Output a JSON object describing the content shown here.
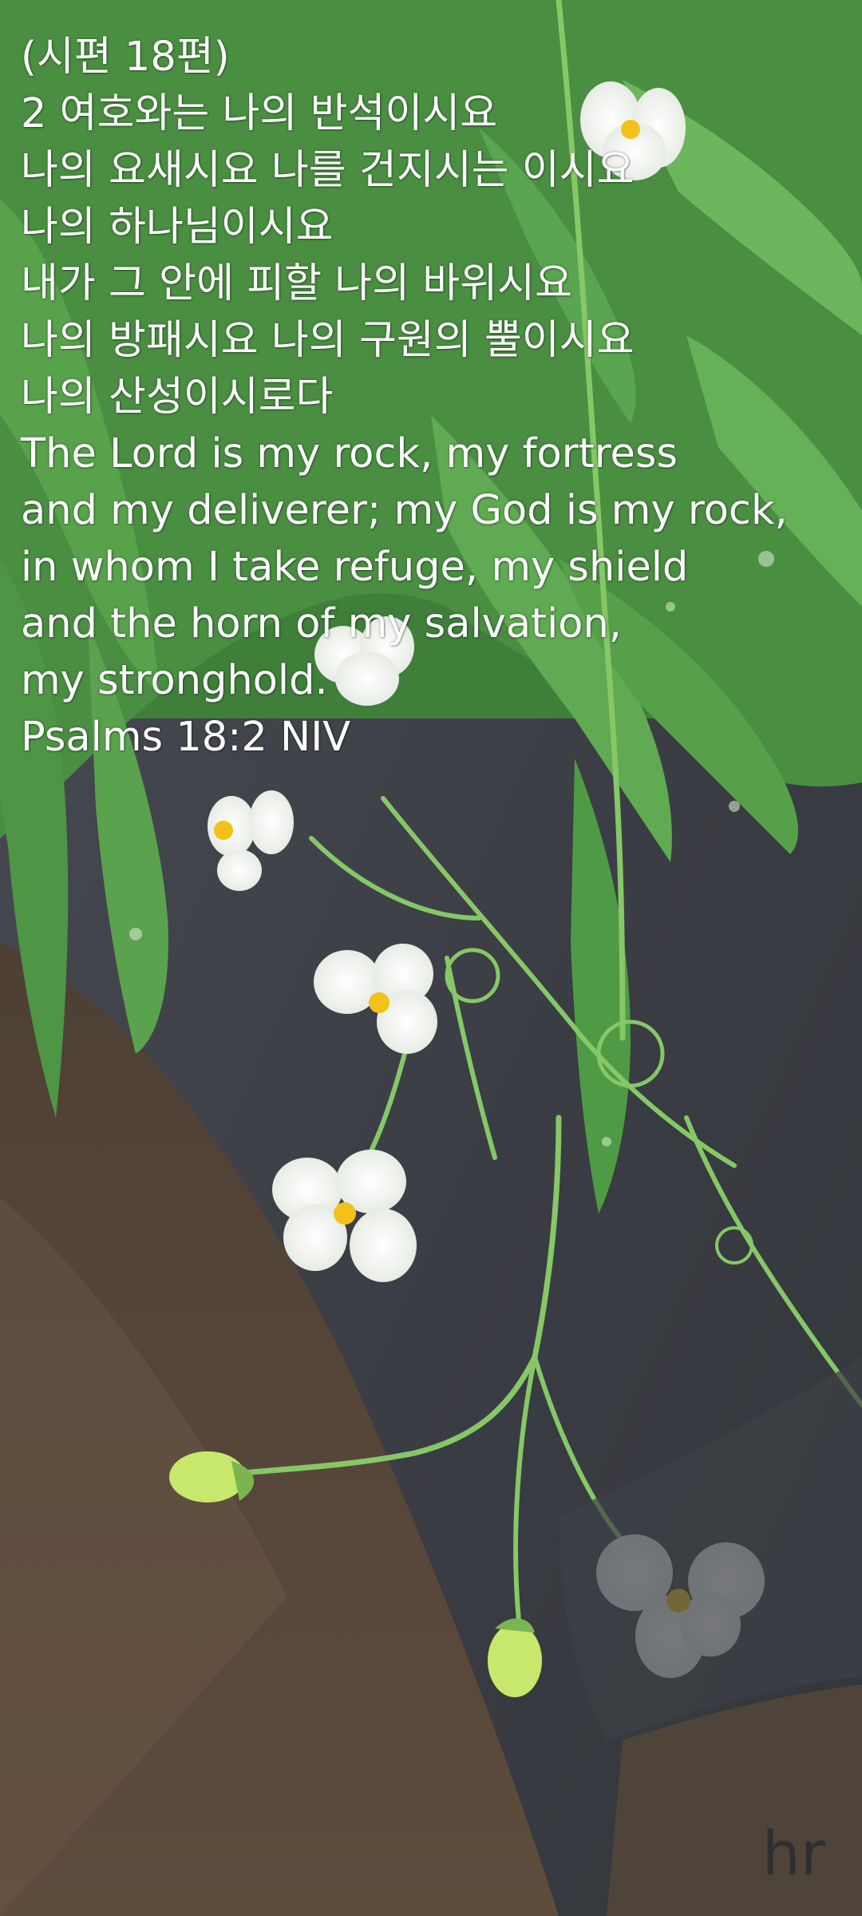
{
  "verse": {
    "korean_lines": [
      "(시편 18편)",
      "2 여호와는 나의 반석이시요",
      "나의 요새시요 나를 건지시는 이시요",
      "나의 하나님이시요",
      "내가 그 안에 피할 나의 바위시요",
      "나의 방패시요 나의 구원의 뿔이시요",
      "나의 산성이시로다"
    ],
    "english_lines": [
      "The Lord is my rock, my fortress",
      "and my deliverer; my God is my rock,",
      "in whom I take refuge, my shield",
      "and the horn of my salvation,",
      "my stronghold.",
      "Psalms 18:2 NIV"
    ]
  },
  "signature": "hr",
  "colors": {
    "text": "#ffffff",
    "leaf": "#4f9a48",
    "leaf_light": "#6fb860",
    "stem": "#7cbf5c",
    "petal": "#f4f6f2",
    "flower_center": "#f2c21a",
    "pavement": "#3a3d42",
    "soil": "#5b4a3c"
  },
  "icons": [
    "fern-leaf",
    "white-flower",
    "flower-bud",
    "tendril"
  ]
}
